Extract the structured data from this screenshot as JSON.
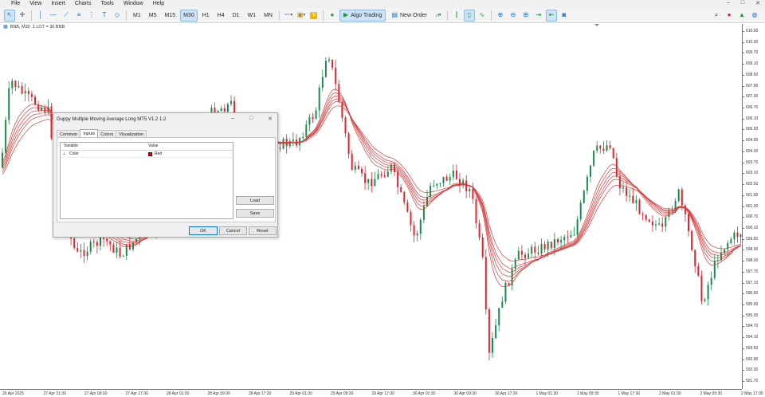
{
  "menu": {
    "items": [
      "File",
      "View",
      "Insert",
      "Charts",
      "Tools",
      "Window",
      "Help"
    ],
    "window_controls": [
      "–",
      "□",
      "✕"
    ]
  },
  "toolbar": {
    "timeframes": [
      "M1",
      "M5",
      "M15",
      "M30",
      "H1",
      "H4",
      "D1",
      "W1",
      "MN"
    ],
    "active_timeframe": "M30",
    "algo_trading_label": "Algo Trading",
    "new_order_label": "New Order"
  },
  "chart_header": {
    "symbol_tf": "BNB, M30",
    "lot_text": "1 LOT = 30 BNB"
  },
  "price_axis": {
    "labels": [
      "610.90",
      "610.30",
      "609.70",
      "609.10",
      "608.50",
      "607.90",
      "607.30",
      "606.70",
      "606.10",
      "605.50",
      "604.90",
      "604.30",
      "603.70",
      "603.10",
      "602.50",
      "601.90",
      "601.30",
      "600.70",
      "600.10",
      "599.50",
      "598.90",
      "598.30",
      "597.70",
      "597.10",
      "596.50",
      "595.90",
      "595.30",
      "594.70",
      "594.10",
      "593.50",
      "592.90",
      "592.30",
      "591.70"
    ]
  },
  "time_axis": {
    "labels": [
      "26 Apr 2025",
      "27 Apr 01:30",
      "27 Apr 09:30",
      "27 Apr 17:30",
      "28 Apr 01:30",
      "28 Apr 09:30",
      "28 Apr 17:30",
      "29 Apr 01:30",
      "29 Apr 09:30",
      "29 Apr 17:30",
      "30 Apr 01:30",
      "30 Apr 09:30",
      "30 Apr 17:30",
      "1 May 01:30",
      "1 May 09:30",
      "1 May 17:30",
      "2 May 01:30",
      "2 May 09:30",
      "2 May 17:30"
    ]
  },
  "dialog": {
    "title": "Guppy Multiple Moving Average Long MT5 V1.2 1.2",
    "controls": [
      "–",
      "□",
      "✕"
    ],
    "tabs": [
      "Common",
      "Inputs",
      "Colors",
      "Visualization"
    ],
    "active_tab": "Inputs",
    "table": {
      "headers": [
        "Variable",
        "Value"
      ],
      "rows": [
        {
          "variable": "Color",
          "value": "Red",
          "swatch_color": "#e00000"
        }
      ]
    },
    "side_buttons": [
      "Load",
      "Save"
    ],
    "footer_buttons": [
      "OK",
      "Cancel",
      "Reset"
    ]
  },
  "colors": {
    "bull_candle": "#1a8a4a",
    "bear_candle": "#e0242c",
    "ma_lines": "#d63a3a",
    "accent": "#0078d7"
  }
}
